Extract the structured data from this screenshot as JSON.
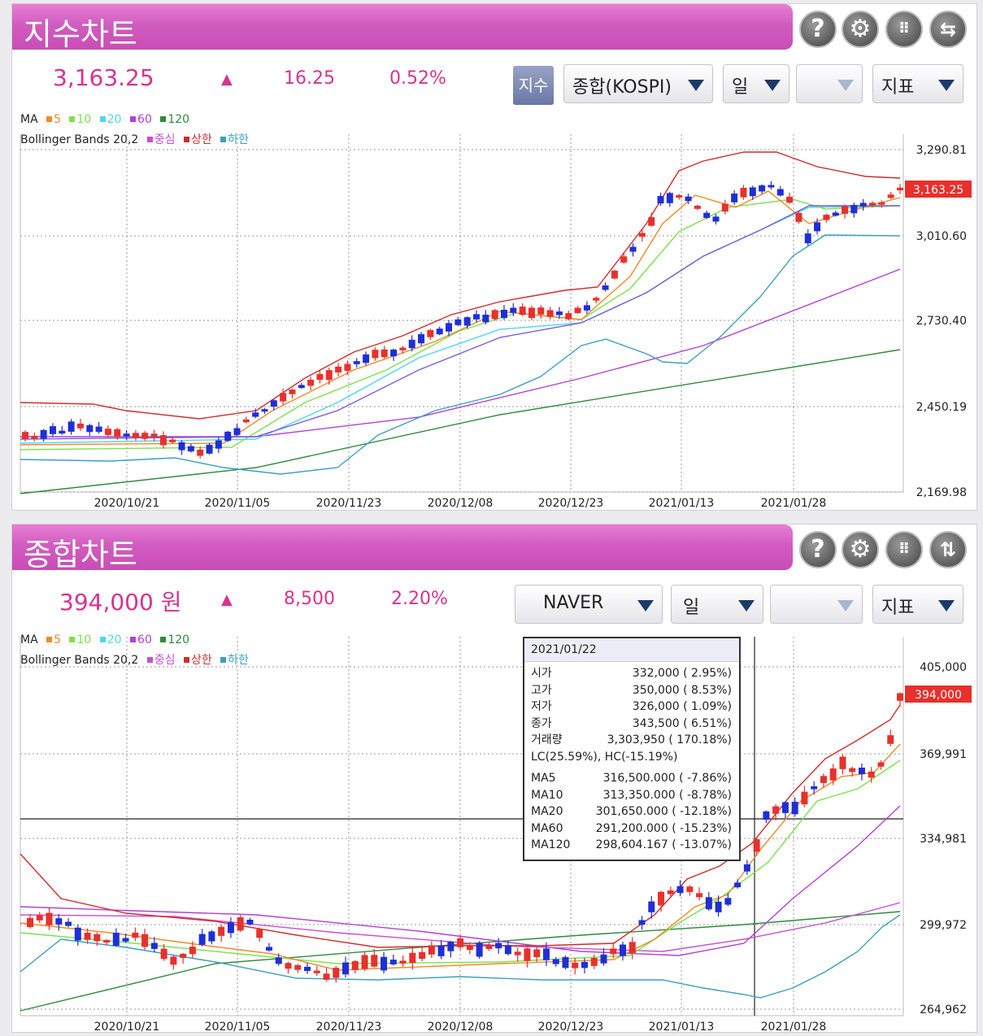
{
  "index_chart": {
    "title": "지수차트",
    "price": "3,163.25",
    "direction": "▲",
    "change": "16.25",
    "change_pct": "0.52%",
    "index_button": "지수",
    "market_select": "종합(KOSPI)",
    "period_select": "일",
    "blank_select": "",
    "indicator_select": "지표",
    "legend_ma_label": "MA",
    "legend_ma": [
      {
        "label": "5",
        "color": "#f08a24"
      },
      {
        "label": "10",
        "color": "#7be24a"
      },
      {
        "label": "20",
        "color": "#4fd6f0"
      },
      {
        "label": "60",
        "color": "#b33fd6"
      },
      {
        "label": "120",
        "color": "#2e8b3a"
      }
    ],
    "legend_bb_label": "Bollinger Bands 20,2",
    "legend_bb": [
      {
        "label": "중심",
        "color": "#c94fd0"
      },
      {
        "label": "상한",
        "color": "#d32b2b"
      },
      {
        "label": "하한",
        "color": "#3aa0c0"
      }
    ],
    "y_labels": [
      "3,290.81",
      "3,010.60",
      "2,730.40",
      "2,450.19",
      "2,169.98"
    ],
    "x_labels": [
      "2020/10/21",
      "2020/11/05",
      "2020/11/23",
      "2020/12/08",
      "2020/12/23",
      "2021/01/13",
      "2021/01/28"
    ],
    "last_price_tag": "3,163.25"
  },
  "stock_chart": {
    "title": "종합차트",
    "price": "394,000 원",
    "direction": "▲",
    "change": "8,500",
    "change_pct": "2.20%",
    "stock_select": "NAVER",
    "period_select": "일",
    "blank_select": "",
    "indicator_select": "지표",
    "legend_ma_label": "MA",
    "legend_bb_label": "Bollinger Bands 20,2",
    "y_labels": [
      "405,000",
      "369,991",
      "334,981",
      "299,972",
      "264,962"
    ],
    "x_labels": [
      "2020/10/21",
      "2020/11/05",
      "2020/11/23",
      "2020/12/08",
      "2020/12/23",
      "2021/01/13",
      "2021/01/28"
    ],
    "last_price_tag": "394,000",
    "tooltip": {
      "date": "2021/01/22",
      "rows": [
        {
          "label": "시가",
          "value": "332,000 (   2.95%)"
        },
        {
          "label": "고가",
          "value": "350,000 (   8.53%)"
        },
        {
          "label": "저가",
          "value": "326,000 (   1.09%)"
        },
        {
          "label": "종가",
          "value": "343,500 (   6.51%)"
        },
        {
          "label": "거래량",
          "value": "3,303,950 ( 170.18%)"
        }
      ],
      "lc_hc": "LC(25.59%), HC(-15.19%)",
      "ma_rows": [
        {
          "label": "MA5",
          "value": "316,500.000 (  -7.86%)"
        },
        {
          "label": "MA10",
          "value": "313,350.000 (  -8.78%)"
        },
        {
          "label": "MA20",
          "value": "301,650.000 ( -12.18%)"
        },
        {
          "label": "MA60",
          "value": "291,200.000 ( -15.23%)"
        },
        {
          "label": "MA120",
          "value": "298,604.167 ( -13.07%)"
        }
      ]
    }
  },
  "colors": {
    "accent": "#d8338f",
    "up_candle": "#e8302c",
    "down_candle": "#1f2fd6",
    "price_tag": "#e8302c"
  },
  "chart_data": [
    {
      "type": "candlestick",
      "title": "지수차트",
      "series_note": "",
      "x": [
        "2020/10/21",
        "2020/11/05",
        "2020/11/23",
        "2020/12/08",
        "2020/12/23",
        "2021/01/13",
        "2021/01/28"
      ],
      "close": [
        2370,
        2360,
        2550,
        2720,
        2800,
        3150,
        3140
      ],
      "ylim": [
        2169.98,
        3290.81
      ],
      "last": 3163.25
    },
    {
      "type": "candlestick",
      "title": "종합차트",
      "x": [
        "2020/10/21",
        "2020/11/05",
        "2020/11/23",
        "2020/12/08",
        "2020/12/23",
        "2021/01/13",
        "2021/01/28"
      ],
      "close": [
        292000,
        290000,
        281000,
        284000,
        282000,
        302000,
        345000
      ],
      "ylim": [
        264962,
        405000
      ],
      "last": 394000
    }
  ]
}
